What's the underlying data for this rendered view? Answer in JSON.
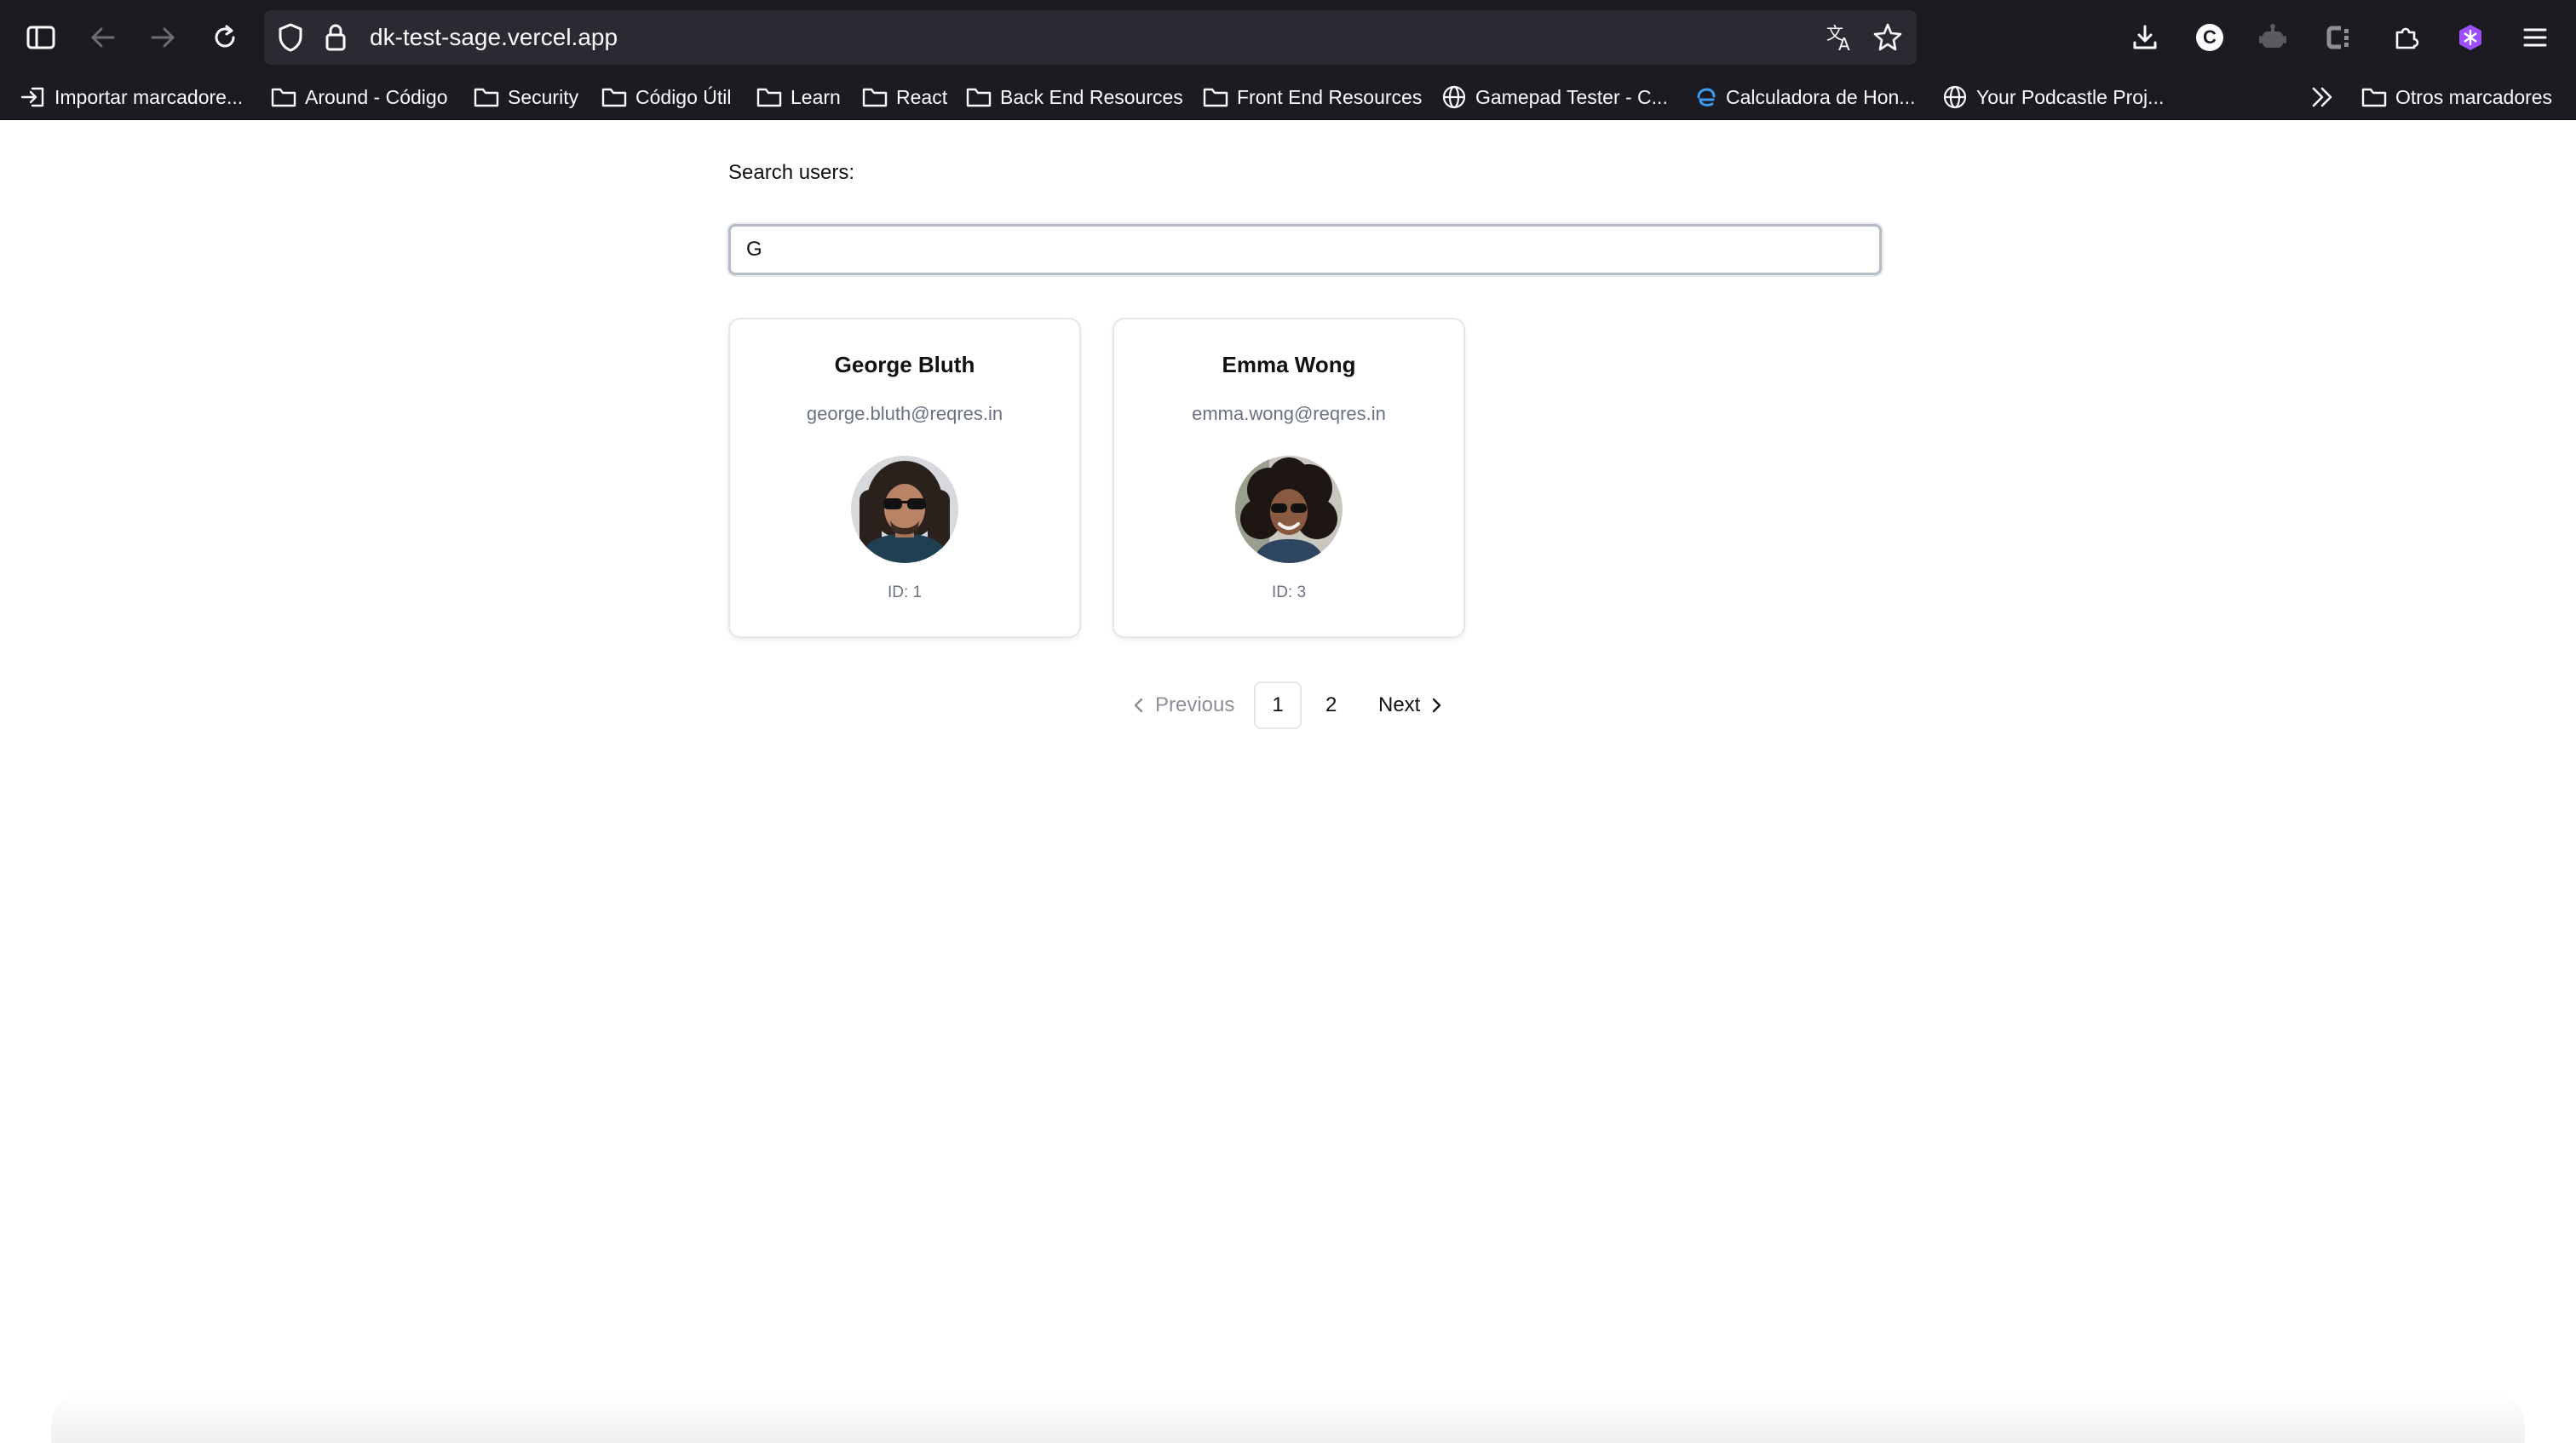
{
  "browser": {
    "url": "dk-test-sage.vercel.app",
    "bookmarks": [
      {
        "label": "Importar marcadore...",
        "icon": "import-icon"
      },
      {
        "label": "Around - Código",
        "icon": "folder-icon"
      },
      {
        "label": "Security",
        "icon": "folder-icon"
      },
      {
        "label": "Código Útil",
        "icon": "folder-icon"
      },
      {
        "label": "Learn",
        "icon": "folder-icon"
      },
      {
        "label": "React",
        "icon": "folder-icon"
      },
      {
        "label": "Back End Resources",
        "icon": "folder-icon"
      },
      {
        "label": "Front End Resources",
        "icon": "folder-icon"
      },
      {
        "label": "Gamepad Tester - C...",
        "icon": "globe-icon"
      },
      {
        "label": "Calculadora de Hon...",
        "icon": "edge-icon"
      },
      {
        "label": "Your Podcastle Proj...",
        "icon": "globe-icon"
      }
    ],
    "other_bookmarks": "Otros marcadores",
    "profile_letter": "C"
  },
  "search": {
    "label": "Search users:",
    "value": "G"
  },
  "users": [
    {
      "name": "George Bluth",
      "email": "george.bluth@reqres.in",
      "id_text": "ID: 1"
    },
    {
      "name": "Emma Wong",
      "email": "emma.wong@reqres.in",
      "id_text": "ID: 3"
    }
  ],
  "pagination": {
    "previous": "Previous",
    "pages": [
      "1",
      "2"
    ],
    "current": "1",
    "next": "Next"
  }
}
